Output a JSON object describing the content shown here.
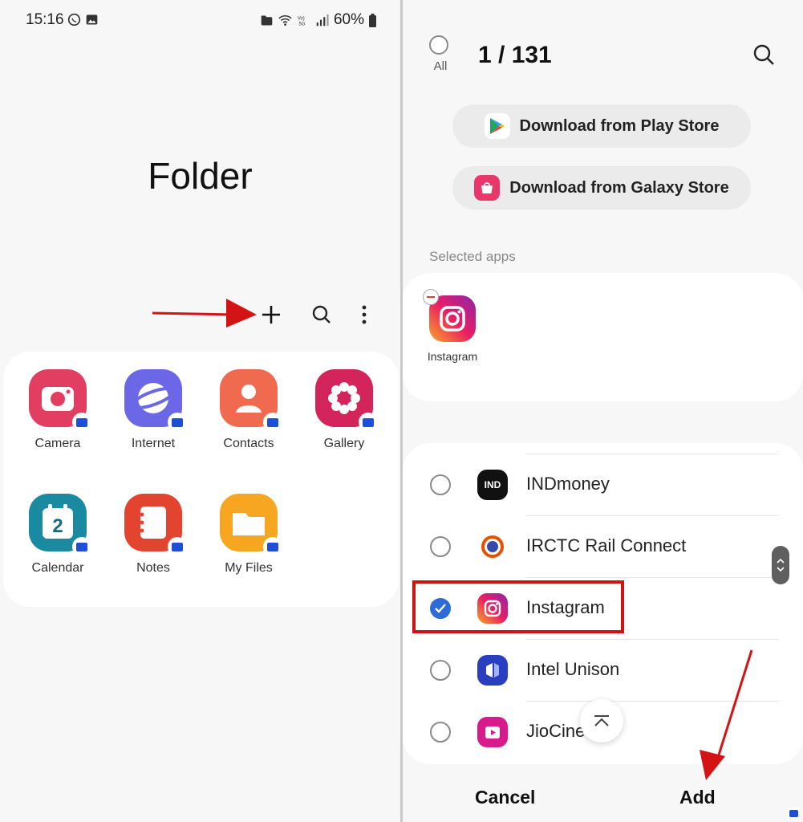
{
  "status_bar": {
    "time": "15:16",
    "battery": "60%"
  },
  "left": {
    "title": "Folder",
    "apps": [
      {
        "label": "Camera"
      },
      {
        "label": "Internet"
      },
      {
        "label": "Contacts"
      },
      {
        "label": "Gallery"
      },
      {
        "label": "Calendar",
        "icon_text": "2"
      },
      {
        "label": "Notes"
      },
      {
        "label": "My Files"
      }
    ]
  },
  "right": {
    "all_label": "All",
    "count": "1 / 131",
    "play_store_label": "Download from Play Store",
    "galaxy_store_label": "Download from Galaxy Store",
    "selected_header": "Selected apps",
    "selected_apps": [
      {
        "label": "Instagram"
      }
    ],
    "list": [
      {
        "name": "INDmoney",
        "icon_text": "IND",
        "checked": false
      },
      {
        "name": "IRCTC Rail Connect",
        "checked": false
      },
      {
        "name": "Instagram",
        "checked": true
      },
      {
        "name": "Intel Unison",
        "checked": false
      },
      {
        "name": "JioCine",
        "checked": false
      }
    ],
    "cancel_label": "Cancel",
    "add_label": "Add"
  },
  "colors": {
    "accent": "#2f6bd8",
    "highlight": "#cf1212",
    "arrow": "#d41414"
  }
}
